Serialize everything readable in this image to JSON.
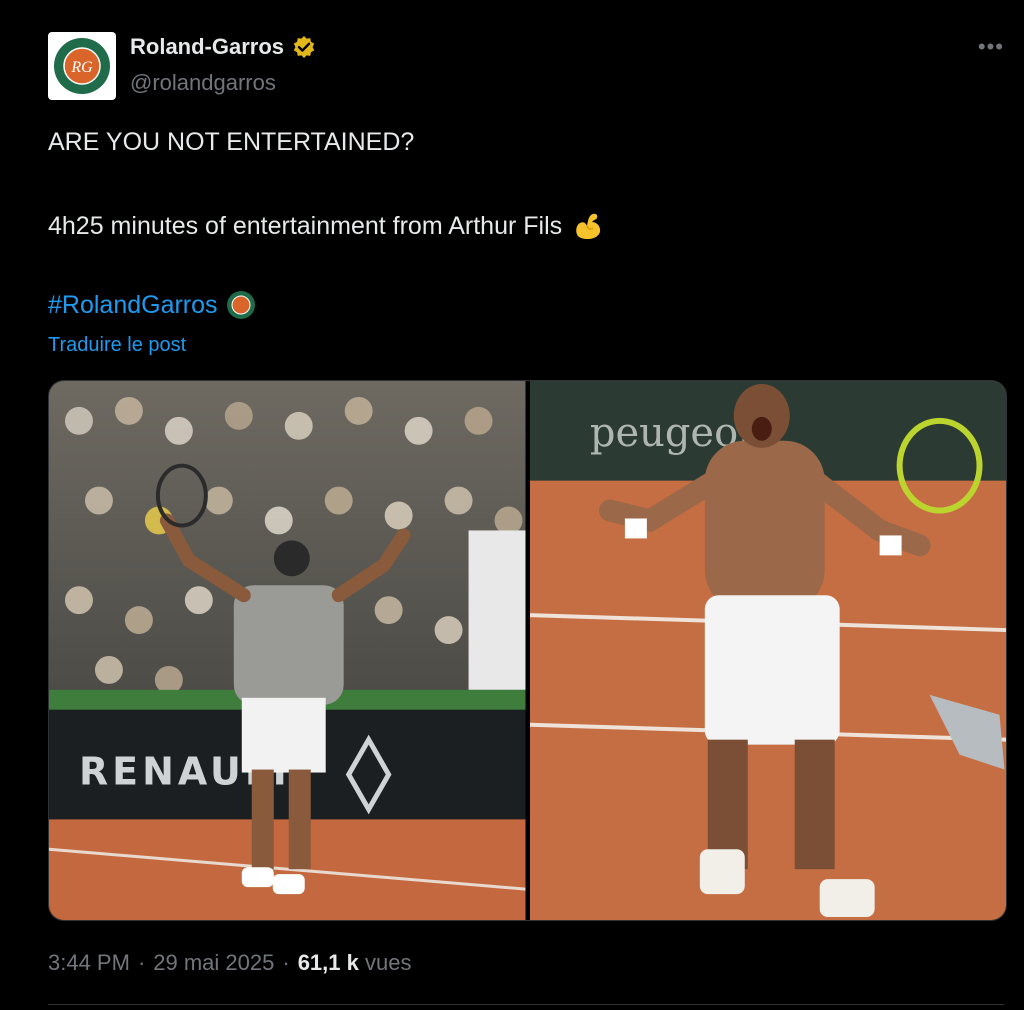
{
  "author": {
    "name": "Roland-Garros",
    "handle": "@rolandgarros",
    "verified": true,
    "avatar_icon": "roland-garros-logo"
  },
  "post": {
    "line1": "ARE YOU NOT ENTERTAINED?",
    "line2": "4h25 minutes of entertainment from Arthur Fils",
    "line2_emoji": "flexed-biceps-icon",
    "hashtag": "#RolandGarros",
    "translate_link": "Traduire le post"
  },
  "media": {
    "count": 2,
    "photo1_banner": "RENAULT",
    "photo2_banner": "peugeot"
  },
  "meta": {
    "time": "3:44 PM",
    "date": "29 mai 2025",
    "views_count": "61,1 k",
    "views_label": "vues",
    "separator": "·"
  },
  "colors": {
    "background": "#000000",
    "text": "#e7e9ea",
    "secondary": "#71767b",
    "link": "#1d9bf0",
    "verified_badge": "#e2b719"
  }
}
